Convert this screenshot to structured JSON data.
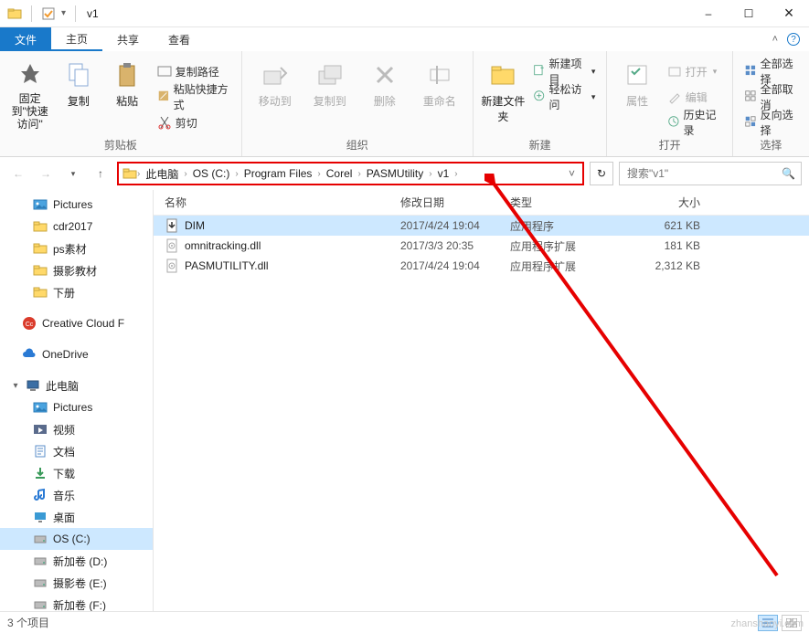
{
  "window": {
    "title": "v1",
    "min": "–",
    "max": "☐",
    "close": "×",
    "qat_down": "▾"
  },
  "tabs": {
    "file": "文件",
    "home": "主页",
    "share": "共享",
    "view": "查看",
    "help_tip": "?"
  },
  "ribbon": {
    "pin_quick": "固定到\"快速访问\"",
    "copy": "复制",
    "paste": "粘贴",
    "copy_path": "复制路径",
    "paste_shortcut": "粘贴快捷方式",
    "cut": "剪切",
    "clipboard_group": "剪贴板",
    "move_to": "移动到",
    "copy_to": "复制到",
    "delete": "删除",
    "rename": "重命名",
    "organize_group": "组织",
    "new_folder": "新建文件夹",
    "new_item": "新建项目",
    "easy_access": "轻松访问",
    "new_group": "新建",
    "properties": "属性",
    "open": "打开",
    "edit": "编辑",
    "history": "历史记录",
    "open_group": "打开",
    "select_all": "全部选择",
    "select_none": "全部取消",
    "invert_selection": "反向选择",
    "select_group": "选择"
  },
  "nav": {
    "breadcrumbs": [
      "此电脑",
      "OS (C:)",
      "Program Files",
      "Corel",
      "PASMUtility",
      "v1"
    ],
    "search_placeholder": "搜索\"v1\""
  },
  "sidebar": {
    "items": [
      {
        "label": "Pictures",
        "icon": "pictures",
        "lvl": 1
      },
      {
        "label": "cdr2017",
        "icon": "folder",
        "lvl": 1
      },
      {
        "label": "ps素材",
        "icon": "folder",
        "lvl": 1
      },
      {
        "label": "摄影教材",
        "icon": "folder",
        "lvl": 1
      },
      {
        "label": "下册",
        "icon": "folder",
        "lvl": 1
      },
      {
        "gap": true
      },
      {
        "label": "Creative Cloud F",
        "icon": "cc",
        "lvl": 0
      },
      {
        "gap": true
      },
      {
        "label": "OneDrive",
        "icon": "onedrive",
        "lvl": 0
      },
      {
        "gap": true
      },
      {
        "label": "此电脑",
        "icon": "pc",
        "lvl": 0,
        "caret": "▾"
      },
      {
        "label": "Pictures",
        "icon": "pictures",
        "lvl": 1
      },
      {
        "label": "视频",
        "icon": "video",
        "lvl": 1
      },
      {
        "label": "文档",
        "icon": "docs",
        "lvl": 1
      },
      {
        "label": "下载",
        "icon": "downloads",
        "lvl": 1
      },
      {
        "label": "音乐",
        "icon": "music",
        "lvl": 1
      },
      {
        "label": "桌面",
        "icon": "desktop",
        "lvl": 1
      },
      {
        "label": "OS (C:)",
        "icon": "drive",
        "lvl": 1,
        "selected": true
      },
      {
        "label": "新加卷 (D:)",
        "icon": "drive",
        "lvl": 1
      },
      {
        "label": "摄影卷 (E:)",
        "icon": "drive",
        "lvl": 1
      },
      {
        "label": "新加卷 (F:)",
        "icon": "drive",
        "lvl": 1
      }
    ]
  },
  "columns": {
    "name": "名称",
    "date": "修改日期",
    "type": "类型",
    "size": "大小"
  },
  "files": [
    {
      "name": "DIM",
      "date": "2017/4/24 19:04",
      "type": "应用程序",
      "size": "621 KB",
      "icon": "exe",
      "selected": true
    },
    {
      "name": "omnitracking.dll",
      "date": "2017/3/3 20:35",
      "type": "应用程序扩展",
      "size": "181 KB",
      "icon": "dll"
    },
    {
      "name": "PASMUTILITY.dll",
      "date": "2017/4/24 19:04",
      "type": "应用程序扩展",
      "size": "2,312 KB",
      "icon": "dll"
    }
  ],
  "status": {
    "count": "3 个项目"
  },
  "watermark": "zhanshaoyi.com"
}
